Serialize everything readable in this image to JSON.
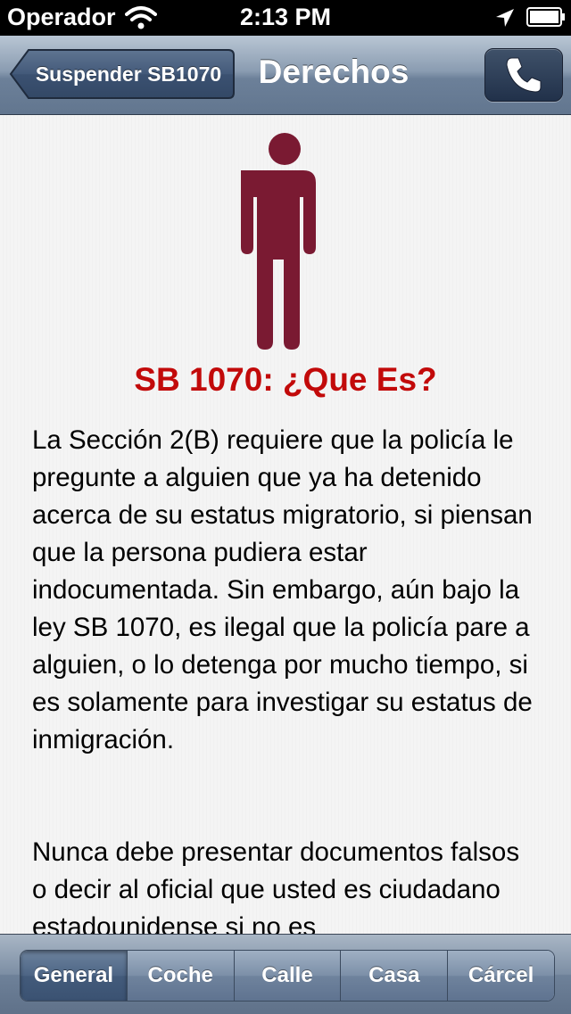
{
  "status_bar": {
    "carrier": "Operador",
    "time": "2:13 PM",
    "icons": [
      "wifi-icon",
      "location-icon",
      "battery-icon"
    ]
  },
  "nav": {
    "back_label": "Suspender SB1070",
    "title": "Derechos",
    "call_icon": "phone-icon"
  },
  "content": {
    "figure_icon": "person-icon",
    "title": "SB 1070: ¿Que Es?",
    "paragraphs": [
      "La Sección 2(B) requiere que la policía le pregunte a alguien que ya ha detenido acerca de su estatus migratorio, si piensan que la persona pudiera estar indocumentada. Sin embargo, aún bajo la ley SB 1070, es ilegal que la policía pare a alguien, o lo detenga por mucho tiempo, si es solamente para investigar su estatus de inmigración.",
      "Nunca debe presentar documentos falsos o decir al oficial que usted es ciudadano estadounidense si no es"
    ]
  },
  "tabs": {
    "items": [
      {
        "label": "General",
        "selected": true
      },
      {
        "label": "Coche",
        "selected": false
      },
      {
        "label": "Calle",
        "selected": false
      },
      {
        "label": "Casa",
        "selected": false
      },
      {
        "label": "Cárcel",
        "selected": false
      }
    ]
  },
  "colors": {
    "accent_title": "#c20a0a",
    "figure": "#7a1a32",
    "nav_bar": "#6c8099"
  }
}
